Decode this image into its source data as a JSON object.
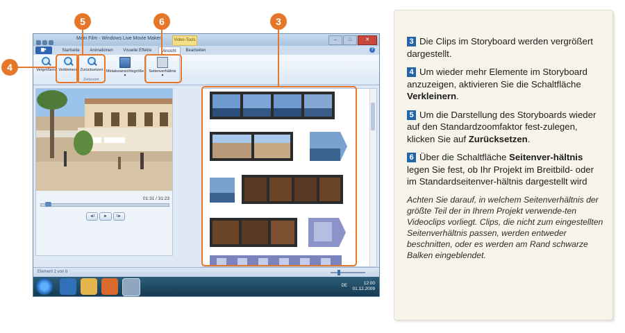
{
  "app": {
    "window_title": "Mein Film - Windows Live Movie Maker",
    "context_tab": "Video-Tools",
    "file_button": "▆▾",
    "tabs": [
      {
        "label": "Startseite"
      },
      {
        "label": "Animationen"
      },
      {
        "label": "Visuelle Effekte"
      },
      {
        "label": "Ansicht",
        "active": true
      },
      {
        "label": "Bearbeiten"
      }
    ],
    "ribbon": {
      "zoom_in_label": "Vergrößern",
      "zoom_out_label": "Verkleinern",
      "reset_label": "Zurücksetzen",
      "thumb_size_label": "Miniaturansichtsgröße",
      "aspect_label": "Seitenverhältnis",
      "group_label": "Zeitzoom"
    },
    "preview": {
      "timecode": "01:31 / 31:23",
      "controls": [
        "◄I",
        "►",
        "I►"
      ]
    },
    "status": {
      "text": "Element 2 von 8"
    },
    "taskbar": {
      "lang": "DE",
      "time": "12:00",
      "date": "01.12.2009"
    }
  },
  "callouts": [
    "3",
    "4",
    "5",
    "6"
  ],
  "text_panel": {
    "items": [
      {
        "num": "3",
        "text": "Die Clips im Storyboard werden vergrößert dargestellt."
      },
      {
        "num": "4",
        "pre": "Um wieder mehr Elemente im Storyboard anzuzeigen, aktivieren Sie die Schaltfläche ",
        "bold": "Verkleinern",
        "post": "."
      },
      {
        "num": "5",
        "pre": "Um die Darstellung des Storyboards wieder auf den Standardzoomfaktor fest-zulegen, klicken Sie auf ",
        "bold": "Zurücksetzen",
        "post": "."
      },
      {
        "num": "6",
        "pre": "Über die Schaltfläche ",
        "bold": "Seitenver-hältnis",
        "post": " legen Sie fest, ob Ihr Projekt im Breitbild- oder im Standardseitenver-hältnis dargestellt wird"
      }
    ],
    "note": "Achten Sie darauf, in welchem Seitenverhältnis der größte Teil der in Ihrem Projekt verwende-ten Videoclips vorliegt. Clips, die nicht zum eingestellten Seitenverhältnis passen, werden entweder beschnitten, oder es werden am Rand schwarze Balken eingeblendet."
  },
  "colors": {
    "callout": "#e6762a",
    "number_square": "#2266a8",
    "panel_bg": "#f7f4e9"
  }
}
